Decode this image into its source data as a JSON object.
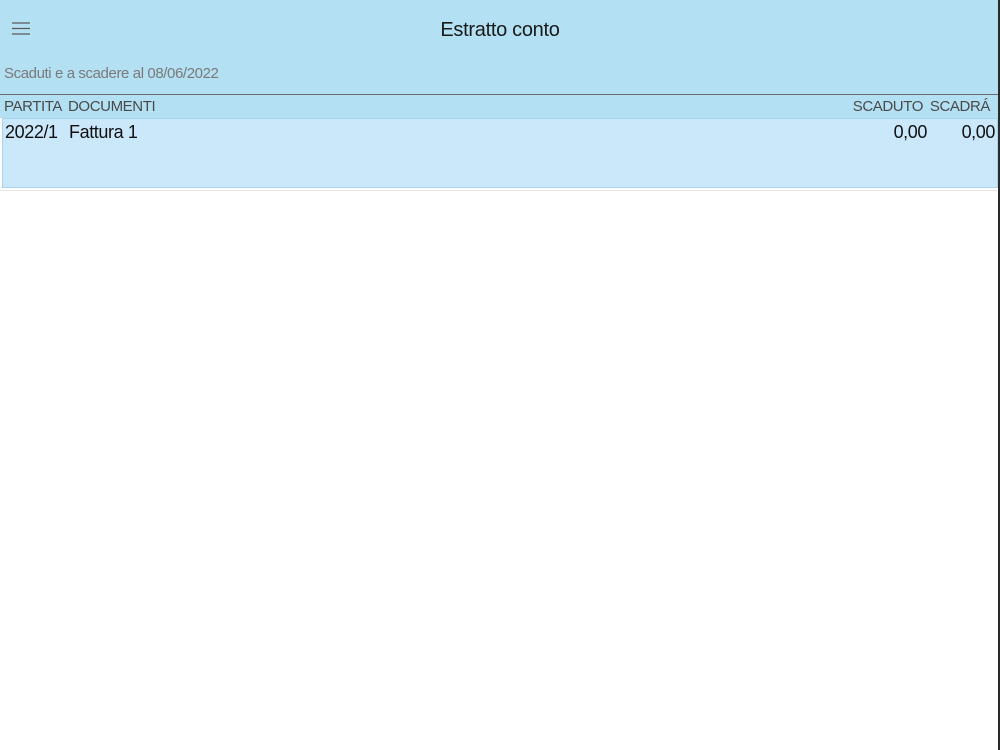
{
  "header": {
    "title": "Estratto conto",
    "subtitle": "Scaduti e a scadere al 08/06/2022",
    "menu_icon": "hamburger-menu-icon"
  },
  "table": {
    "columns": {
      "partita": "PARTITA",
      "documenti": "DOCUMENTI",
      "scaduto": "SCADUTO",
      "scadra": "SCADRÁ"
    },
    "rows": [
      {
        "partita": "2022/1",
        "documenti": "Fattura 1",
        "scaduto": "0,00",
        "scadra": "0,00"
      }
    ]
  },
  "colors": {
    "header_bg": "#b3e0f2",
    "row_bg": "#cbe8fb"
  }
}
